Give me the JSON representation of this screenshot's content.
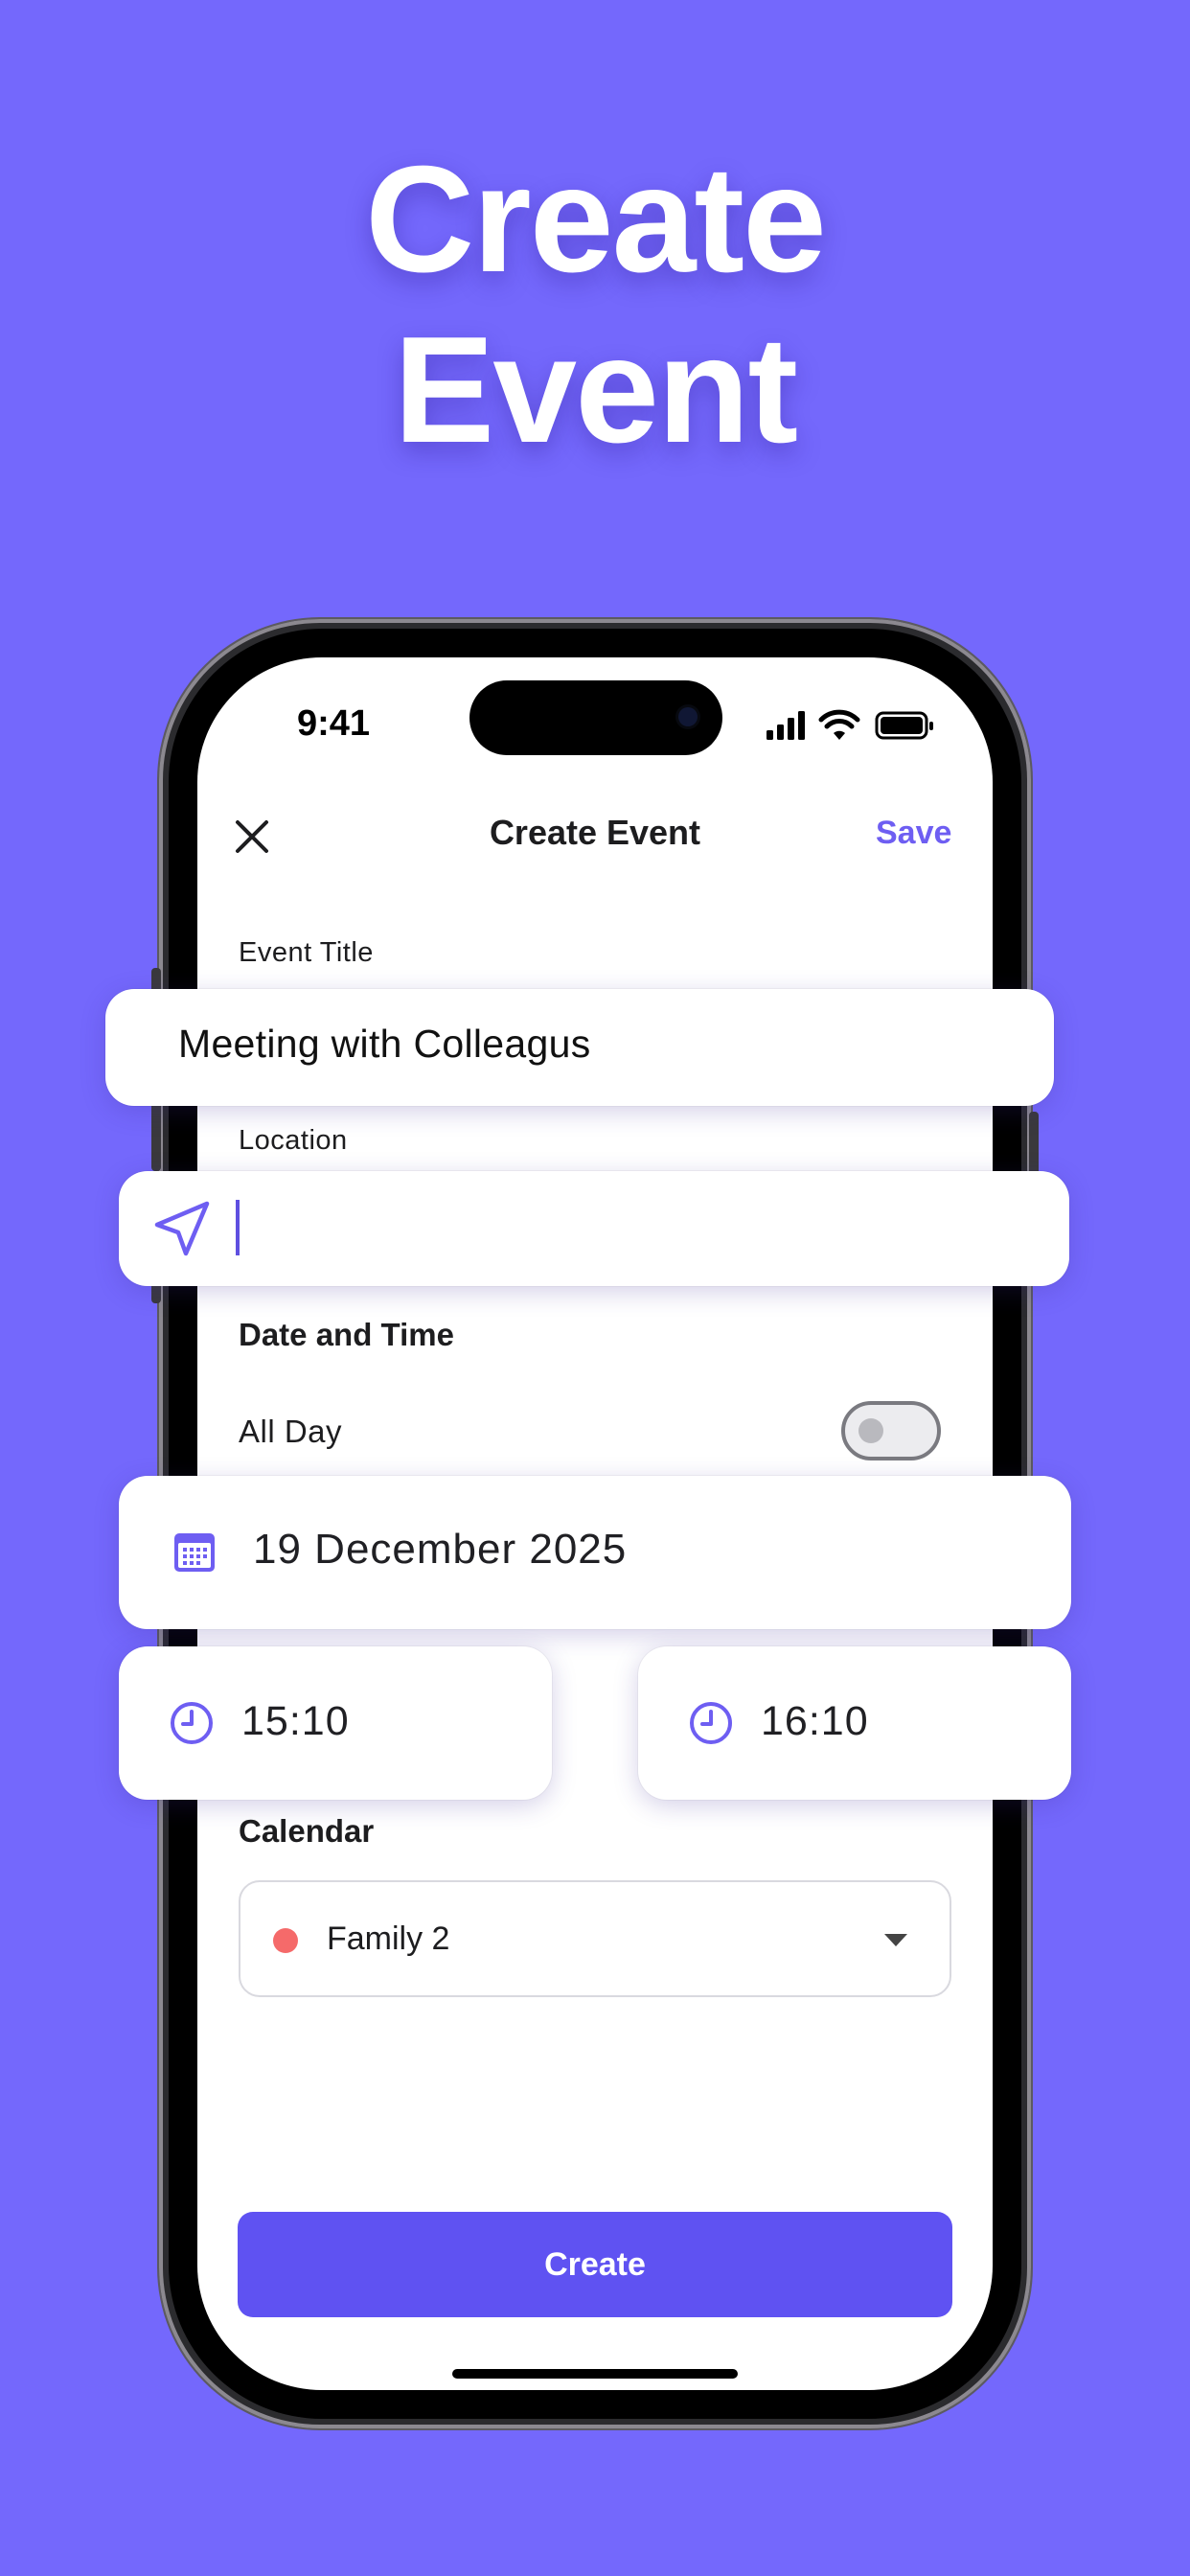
{
  "headline": {
    "line1": "Create",
    "line2": "Event"
  },
  "status_bar": {
    "time": "9:41"
  },
  "nav": {
    "title": "Create Event",
    "save_label": "Save"
  },
  "form": {
    "event_title_label": "Event Title",
    "event_title_value": "Meeting with Colleagus",
    "location_label": "Location",
    "location_value": "",
    "date_time_label": "Date and Time",
    "all_day_label": "All Day",
    "all_day_enabled": false,
    "date_value": "19 December 2025",
    "start_time": "15:10",
    "end_time": "16:10",
    "calendar_label": "Calendar",
    "calendar_value": "Family 2",
    "calendar_color": "#f56a6a"
  },
  "create_button_label": "Create",
  "colors": {
    "background": "#7468fc",
    "accent": "#6e5ef2",
    "button": "#5f52f2"
  },
  "icons": [
    "close-icon",
    "location-arrow-icon",
    "calendar-icon",
    "clock-icon",
    "chevron-down-icon",
    "signal-icon",
    "wifi-icon",
    "battery-icon"
  ]
}
